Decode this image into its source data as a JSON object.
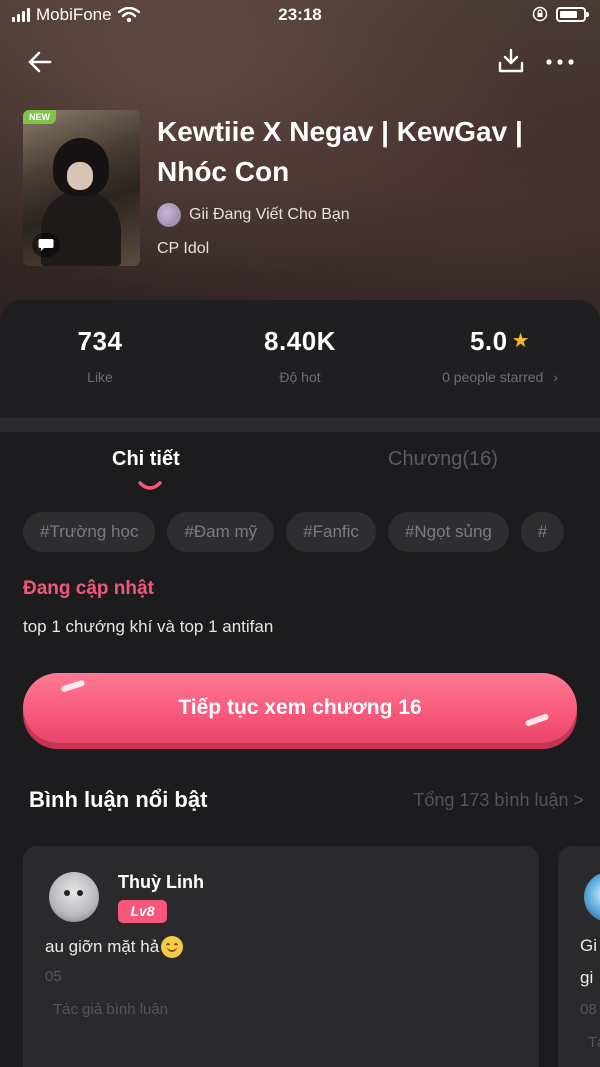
{
  "status_bar": {
    "carrier": "MobiFone",
    "time": "23:18"
  },
  "comic": {
    "badge": "NEW",
    "title": "Kewtiie X Negav | KewGav | Nhóc Con",
    "author": "Gii Đang Viết Cho Bạn",
    "category": "CP Idol"
  },
  "stats": {
    "likes": {
      "value": "734",
      "label": "Like"
    },
    "hot": {
      "value": "8.40K",
      "label": "Độ hot"
    },
    "rating": {
      "value": "5.0",
      "label": "0 people starred",
      "chevron": "›"
    }
  },
  "tabs": {
    "detail": "Chi tiết",
    "chapters": "Chương(16)"
  },
  "tags": [
    "#Trường học",
    "#Đam mỹ",
    "#Fanfic",
    "#Ngọt sủng",
    "#"
  ],
  "status_text": "Đang cập nhật",
  "description": "top 1 chướng khí và top 1 antifan",
  "cta": {
    "label": "Tiếp tục xem chương 16"
  },
  "comments": {
    "heading": "Bình luận nổi bật",
    "total": "Tổng 173 bình luận >",
    "items": [
      {
        "name": "Thuỳ Linh",
        "level": "Lv8",
        "text": "au giỡn mặt hả",
        "date": "05",
        "role": "Tác giả bình luận"
      },
      {
        "text_line1": "Gi",
        "text_line2": "gi",
        "date": "08",
        "role": "Tá"
      }
    ]
  },
  "icons": {
    "back": "arrow-left-icon",
    "download": "download-icon",
    "more": "more-dots-icon",
    "star": "star-icon",
    "chat": "chat-bubble-icon"
  },
  "colors": {
    "accent_pink": "#f7587a",
    "star_gold": "#f5b82e",
    "new_badge_green": "#7ec44a",
    "background": "#1c1c1e"
  }
}
